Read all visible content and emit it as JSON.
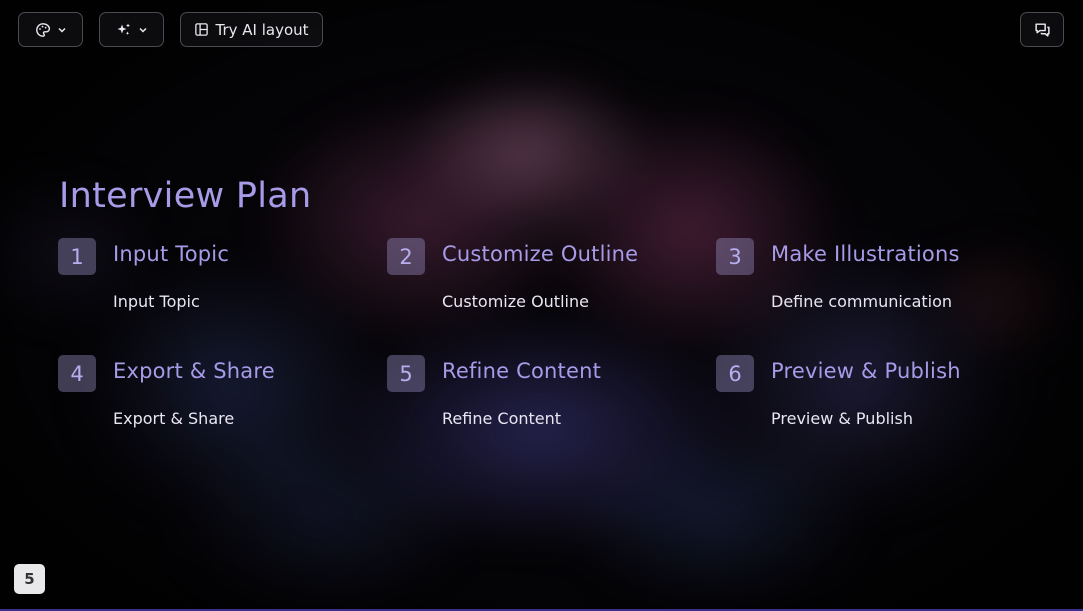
{
  "toolbar": {
    "theme_icon": "palette-icon",
    "ai_icon": "sparkles-icon",
    "dropdown_icon": "chevron-down-icon",
    "layout_icon": "layout-icon",
    "layout_label": "Try AI layout",
    "chat_icon": "chat-icon"
  },
  "slide": {
    "title": "Interview Plan",
    "steps": [
      {
        "number": "1",
        "title": "Input Topic",
        "description": "Input Topic"
      },
      {
        "number": "2",
        "title": "Customize Outline",
        "description": "Customize Outline"
      },
      {
        "number": "3",
        "title": "Make Illustrations",
        "description": "Define communication"
      },
      {
        "number": "4",
        "title": "Export & Share",
        "description": "Export & Share"
      },
      {
        "number": "5",
        "title": "Refine Content",
        "description": "Refine Content"
      },
      {
        "number": "6",
        "title": "Preview & Publish",
        "description": "Preview & Publish"
      }
    ]
  },
  "page_number": "5",
  "colors": {
    "accent": "#a79be8",
    "step_badge": "#5c5474",
    "text": "#e9e6f3",
    "background": "#050407"
  }
}
